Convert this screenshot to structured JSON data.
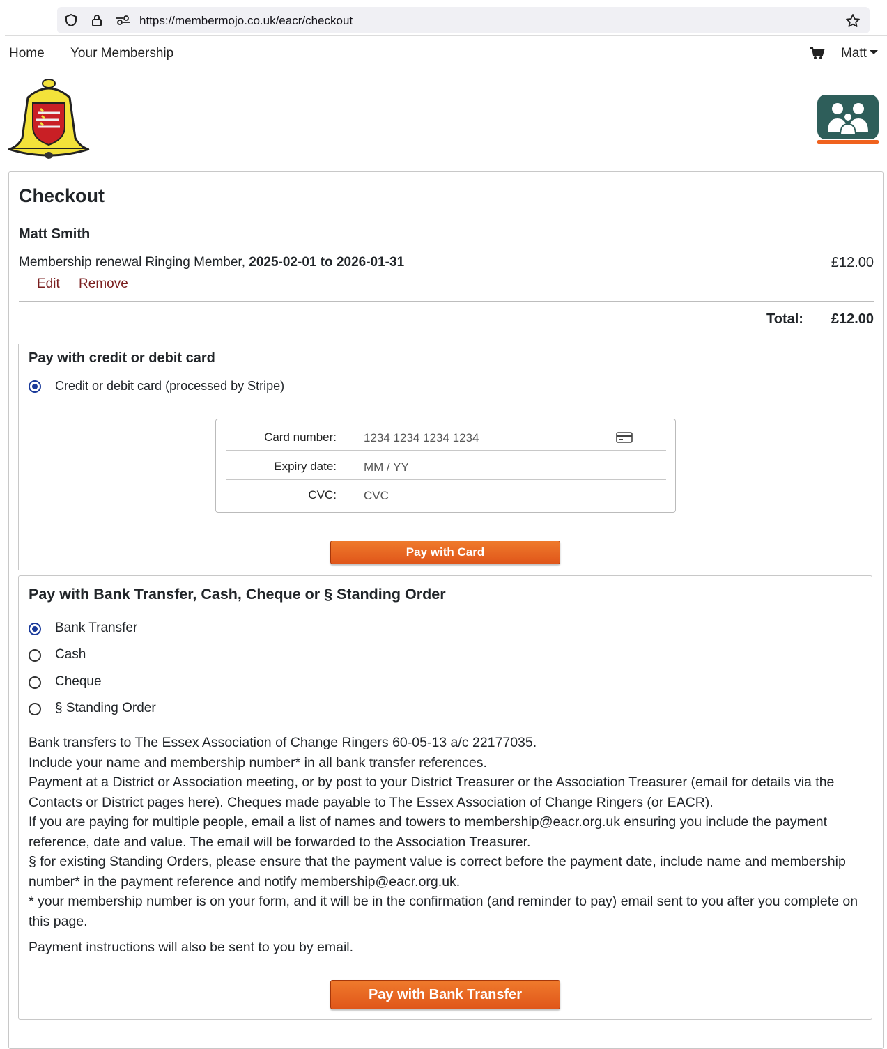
{
  "browser": {
    "url": "https://membermojo.co.uk/eacr/checkout",
    "shield_icon": "shield-icon",
    "lock_icon": "lock-icon",
    "permissions_icon": "permissions-icon",
    "bookmark_icon": "star-icon"
  },
  "nav": {
    "home": "Home",
    "membership": "Your Membership",
    "cart_icon": "cart-icon",
    "user": "Matt"
  },
  "checkout": {
    "title": "Checkout",
    "member_name": "Matt Smith",
    "item": {
      "label": "Membership renewal",
      "type": "Ringing Member,",
      "dates": "2025-02-01 to 2026-01-31",
      "price": "£12.00",
      "edit": "Edit",
      "remove": "Remove"
    },
    "total_label": "Total:",
    "total_value": "£12.00"
  },
  "card_payment": {
    "heading": "Pay with credit or debit card",
    "option": "Credit or debit card (processed by Stripe)",
    "card_number_label": "Card number:",
    "card_number_placeholder": "1234 1234 1234 1234",
    "expiry_label": "Expiry date:",
    "expiry_placeholder": "MM / YY",
    "cvc_label": "CVC:",
    "cvc_placeholder": "CVC",
    "button": "Pay with Card"
  },
  "bank_payment": {
    "heading": "Pay with Bank Transfer, Cash, Cheque or § Standing Order",
    "options": [
      "Bank Transfer",
      "Cash",
      "Cheque",
      "§ Standing Order"
    ],
    "selected": "Bank Transfer",
    "info": [
      "Bank transfers to The Essex Association of Change Ringers 60-05-13 a/c 22177035.",
      "Include your name and membership number* in all bank transfer references.",
      "Payment at a District or Association meeting, or by post to your District Treasurer or the Association Treasurer (email for details via the Contacts or District pages here). Cheques made payable to The Essex Association of Change Ringers (or EACR).",
      "If you are paying for multiple people, email a list of names and towers to membership@eacr.org.uk ensuring you include the payment reference, date and value. The email will be forwarded to the Association Treasurer.",
      "§ for existing Standing Orders, please ensure that the payment value is correct before the payment date, include name and membership number* in the payment reference and notify membership@eacr.org.uk.",
      "* your membership number is on your form, and it will be in the confirmation (and reminder to pay) email sent to you after you complete on this page."
    ],
    "notice": "Payment instructions will also be sent to you by email.",
    "button": "Pay with Bank Transfer"
  },
  "colors": {
    "button_orange": "#e0561a",
    "radio_selected": "#1a3a9a",
    "link_maroon": "#7a1f1f",
    "logo_teal": "#2e5e5a"
  }
}
